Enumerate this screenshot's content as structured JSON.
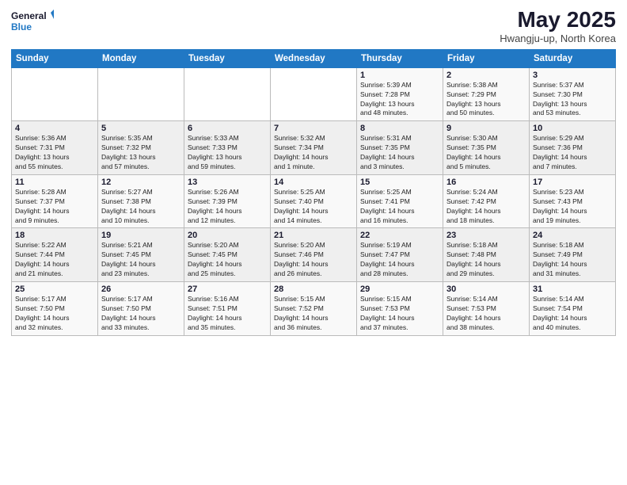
{
  "logo": {
    "line1": "General",
    "line2": "Blue"
  },
  "title": "May 2025",
  "location": "Hwangju-up, North Korea",
  "headers": [
    "Sunday",
    "Monday",
    "Tuesday",
    "Wednesday",
    "Thursday",
    "Friday",
    "Saturday"
  ],
  "weeks": [
    [
      {
        "day": "",
        "info": ""
      },
      {
        "day": "",
        "info": ""
      },
      {
        "day": "",
        "info": ""
      },
      {
        "day": "",
        "info": ""
      },
      {
        "day": "1",
        "info": "Sunrise: 5:39 AM\nSunset: 7:28 PM\nDaylight: 13 hours\nand 48 minutes."
      },
      {
        "day": "2",
        "info": "Sunrise: 5:38 AM\nSunset: 7:29 PM\nDaylight: 13 hours\nand 50 minutes."
      },
      {
        "day": "3",
        "info": "Sunrise: 5:37 AM\nSunset: 7:30 PM\nDaylight: 13 hours\nand 53 minutes."
      }
    ],
    [
      {
        "day": "4",
        "info": "Sunrise: 5:36 AM\nSunset: 7:31 PM\nDaylight: 13 hours\nand 55 minutes."
      },
      {
        "day": "5",
        "info": "Sunrise: 5:35 AM\nSunset: 7:32 PM\nDaylight: 13 hours\nand 57 minutes."
      },
      {
        "day": "6",
        "info": "Sunrise: 5:33 AM\nSunset: 7:33 PM\nDaylight: 13 hours\nand 59 minutes."
      },
      {
        "day": "7",
        "info": "Sunrise: 5:32 AM\nSunset: 7:34 PM\nDaylight: 14 hours\nand 1 minute."
      },
      {
        "day": "8",
        "info": "Sunrise: 5:31 AM\nSunset: 7:35 PM\nDaylight: 14 hours\nand 3 minutes."
      },
      {
        "day": "9",
        "info": "Sunrise: 5:30 AM\nSunset: 7:35 PM\nDaylight: 14 hours\nand 5 minutes."
      },
      {
        "day": "10",
        "info": "Sunrise: 5:29 AM\nSunset: 7:36 PM\nDaylight: 14 hours\nand 7 minutes."
      }
    ],
    [
      {
        "day": "11",
        "info": "Sunrise: 5:28 AM\nSunset: 7:37 PM\nDaylight: 14 hours\nand 9 minutes."
      },
      {
        "day": "12",
        "info": "Sunrise: 5:27 AM\nSunset: 7:38 PM\nDaylight: 14 hours\nand 10 minutes."
      },
      {
        "day": "13",
        "info": "Sunrise: 5:26 AM\nSunset: 7:39 PM\nDaylight: 14 hours\nand 12 minutes."
      },
      {
        "day": "14",
        "info": "Sunrise: 5:25 AM\nSunset: 7:40 PM\nDaylight: 14 hours\nand 14 minutes."
      },
      {
        "day": "15",
        "info": "Sunrise: 5:25 AM\nSunset: 7:41 PM\nDaylight: 14 hours\nand 16 minutes."
      },
      {
        "day": "16",
        "info": "Sunrise: 5:24 AM\nSunset: 7:42 PM\nDaylight: 14 hours\nand 18 minutes."
      },
      {
        "day": "17",
        "info": "Sunrise: 5:23 AM\nSunset: 7:43 PM\nDaylight: 14 hours\nand 19 minutes."
      }
    ],
    [
      {
        "day": "18",
        "info": "Sunrise: 5:22 AM\nSunset: 7:44 PM\nDaylight: 14 hours\nand 21 minutes."
      },
      {
        "day": "19",
        "info": "Sunrise: 5:21 AM\nSunset: 7:45 PM\nDaylight: 14 hours\nand 23 minutes."
      },
      {
        "day": "20",
        "info": "Sunrise: 5:20 AM\nSunset: 7:45 PM\nDaylight: 14 hours\nand 25 minutes."
      },
      {
        "day": "21",
        "info": "Sunrise: 5:20 AM\nSunset: 7:46 PM\nDaylight: 14 hours\nand 26 minutes."
      },
      {
        "day": "22",
        "info": "Sunrise: 5:19 AM\nSunset: 7:47 PM\nDaylight: 14 hours\nand 28 minutes."
      },
      {
        "day": "23",
        "info": "Sunrise: 5:18 AM\nSunset: 7:48 PM\nDaylight: 14 hours\nand 29 minutes."
      },
      {
        "day": "24",
        "info": "Sunrise: 5:18 AM\nSunset: 7:49 PM\nDaylight: 14 hours\nand 31 minutes."
      }
    ],
    [
      {
        "day": "25",
        "info": "Sunrise: 5:17 AM\nSunset: 7:50 PM\nDaylight: 14 hours\nand 32 minutes."
      },
      {
        "day": "26",
        "info": "Sunrise: 5:17 AM\nSunset: 7:50 PM\nDaylight: 14 hours\nand 33 minutes."
      },
      {
        "day": "27",
        "info": "Sunrise: 5:16 AM\nSunset: 7:51 PM\nDaylight: 14 hours\nand 35 minutes."
      },
      {
        "day": "28",
        "info": "Sunrise: 5:15 AM\nSunset: 7:52 PM\nDaylight: 14 hours\nand 36 minutes."
      },
      {
        "day": "29",
        "info": "Sunrise: 5:15 AM\nSunset: 7:53 PM\nDaylight: 14 hours\nand 37 minutes."
      },
      {
        "day": "30",
        "info": "Sunrise: 5:14 AM\nSunset: 7:53 PM\nDaylight: 14 hours\nand 38 minutes."
      },
      {
        "day": "31",
        "info": "Sunrise: 5:14 AM\nSunset: 7:54 PM\nDaylight: 14 hours\nand 40 minutes."
      }
    ]
  ]
}
